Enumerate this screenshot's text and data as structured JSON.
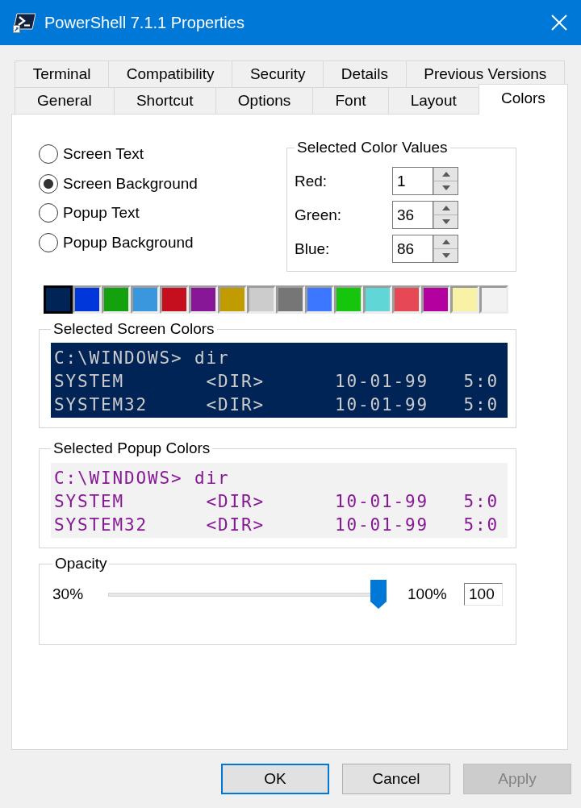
{
  "window": {
    "title": "PowerShell 7.1.1 Properties"
  },
  "tab_rows": [
    {
      "tabs": [
        {
          "label": "Terminal",
          "selected": false
        },
        {
          "label": "Compatibility",
          "selected": false
        },
        {
          "label": "Security",
          "selected": false
        },
        {
          "label": "Details",
          "selected": false
        },
        {
          "label": "Previous Versions",
          "selected": false
        }
      ]
    },
    {
      "tabs": [
        {
          "label": "General",
          "selected": false
        },
        {
          "label": "Shortcut",
          "selected": false
        },
        {
          "label": "Options",
          "selected": false
        },
        {
          "label": "Font",
          "selected": false
        },
        {
          "label": "Layout",
          "selected": false
        },
        {
          "label": "Colors",
          "selected": true
        }
      ]
    }
  ],
  "color_targets": [
    {
      "label": "Screen Text",
      "selected": false
    },
    {
      "label": "Screen Background",
      "selected": true
    },
    {
      "label": "Popup Text",
      "selected": false
    },
    {
      "label": "Popup Background",
      "selected": false
    }
  ],
  "selected_color_values": {
    "title": "Selected Color Values",
    "fields": [
      {
        "label": "Red:",
        "value": "1"
      },
      {
        "label": "Green:",
        "value": "36"
      },
      {
        "label": "Blue:",
        "value": "86"
      }
    ]
  },
  "palette": [
    {
      "color": "#012456",
      "selected": true
    },
    {
      "color": "#0037da",
      "selected": false
    },
    {
      "color": "#13a10e",
      "selected": false
    },
    {
      "color": "#3a96dd",
      "selected": false
    },
    {
      "color": "#c50f1f",
      "selected": false
    },
    {
      "color": "#881798",
      "selected": false
    },
    {
      "color": "#c19c00",
      "selected": false
    },
    {
      "color": "#cccccc",
      "selected": false
    },
    {
      "color": "#767676",
      "selected": false
    },
    {
      "color": "#3b78ff",
      "selected": false
    },
    {
      "color": "#16c60c",
      "selected": false
    },
    {
      "color": "#61d6d6",
      "selected": false
    },
    {
      "color": "#e74856",
      "selected": false
    },
    {
      "color": "#b4009e",
      "selected": false
    },
    {
      "color": "#f9f1a5",
      "selected": false
    },
    {
      "color": "#f2f2f2",
      "selected": false
    }
  ],
  "screen_colors": {
    "title": "Selected Screen Colors",
    "lines": [
      "C:\\WINDOWS> dir",
      "SYSTEM       <DIR>      10-01-99   5:0",
      "SYSTEM32     <DIR>      10-01-99   5:0"
    ]
  },
  "popup_colors": {
    "title": "Selected Popup Colors",
    "lines": [
      "C:\\WINDOWS> dir",
      "SYSTEM       <DIR>      10-01-99   5:0",
      "SYSTEM32     <DIR>      10-01-99   5:0"
    ]
  },
  "opacity": {
    "title": "Opacity",
    "min_label": "30%",
    "max_label": "100%",
    "level": 1,
    "value": "100"
  },
  "buttons": [
    {
      "label": "OK",
      "focused": true,
      "disabled": false
    },
    {
      "label": "Cancel",
      "focused": false,
      "disabled": false
    },
    {
      "label": "Apply",
      "focused": false,
      "disabled": true
    }
  ]
}
